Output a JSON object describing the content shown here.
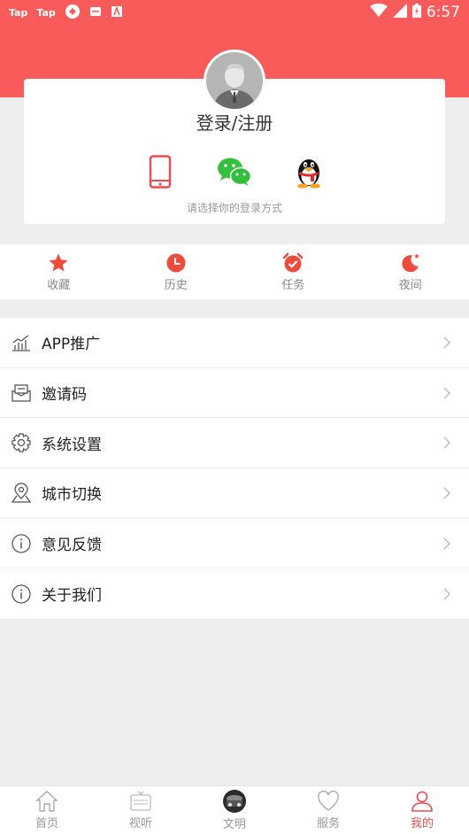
{
  "status_bar": {
    "apps": [
      "Tap",
      "Tap"
    ],
    "time": "6:57"
  },
  "profile": {
    "login_title": "登录/注册",
    "login_hint": "请选择你的登录方式",
    "methods": [
      "phone-icon",
      "wechat-icon",
      "qq-icon"
    ]
  },
  "quick": [
    {
      "label": "收藏",
      "icon": "star-icon"
    },
    {
      "label": "历史",
      "icon": "clock-icon"
    },
    {
      "label": "任务",
      "icon": "alarm-icon"
    },
    {
      "label": "夜间",
      "icon": "moon-icon"
    }
  ],
  "menu": [
    {
      "label": "APP推广",
      "icon": "chart-icon"
    },
    {
      "label": "邀请码",
      "icon": "envelope-icon"
    },
    {
      "label": "系统设置",
      "icon": "gear-icon"
    },
    {
      "label": "城市切换",
      "icon": "location-icon"
    },
    {
      "label": "意见反馈",
      "icon": "info-icon"
    },
    {
      "label": "关于我们",
      "icon": "info-icon"
    }
  ],
  "tabs": [
    {
      "label": "首页",
      "icon": "home-icon"
    },
    {
      "label": "视听",
      "icon": "tv-icon"
    },
    {
      "label": "文明",
      "icon": "civilization-icon"
    },
    {
      "label": "服务",
      "icon": "heart-icon"
    },
    {
      "label": "我的",
      "icon": "user-icon",
      "active": true
    }
  ],
  "colors": {
    "accent": "#f95b5b",
    "active_tab": "#f04b4b",
    "background": "#eeeeee"
  }
}
